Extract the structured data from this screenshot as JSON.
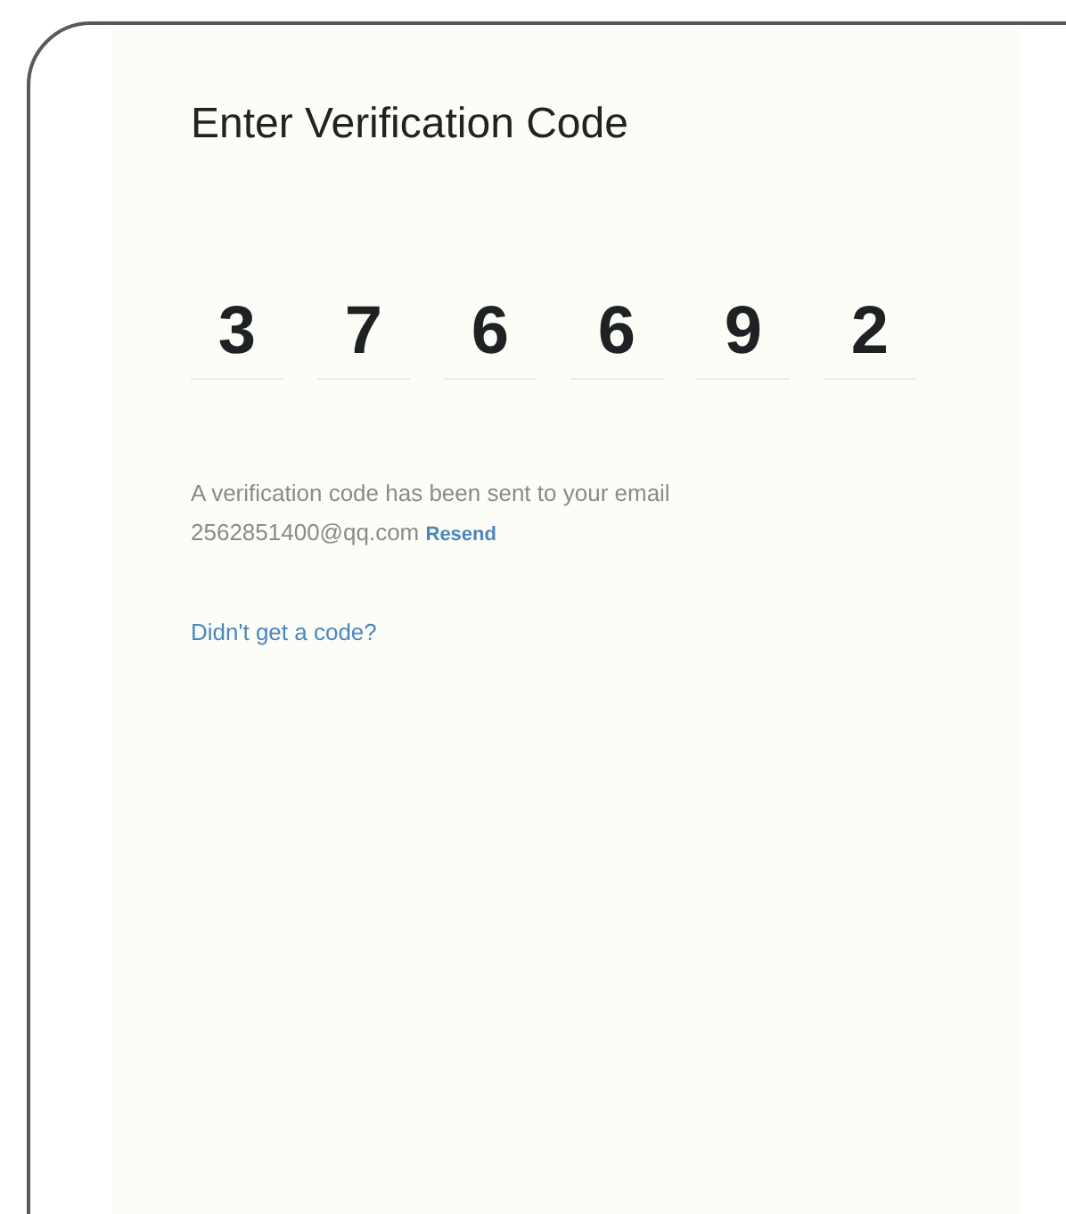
{
  "title": "Enter Verification Code",
  "code_digits": [
    "3",
    "7",
    "6",
    "6",
    "9",
    "2"
  ],
  "message": {
    "text": "A verification code has been sent to your email",
    "email": "2562851400@qq.com",
    "resend_link": "Resend"
  },
  "help_link": "Didn't get a code?"
}
